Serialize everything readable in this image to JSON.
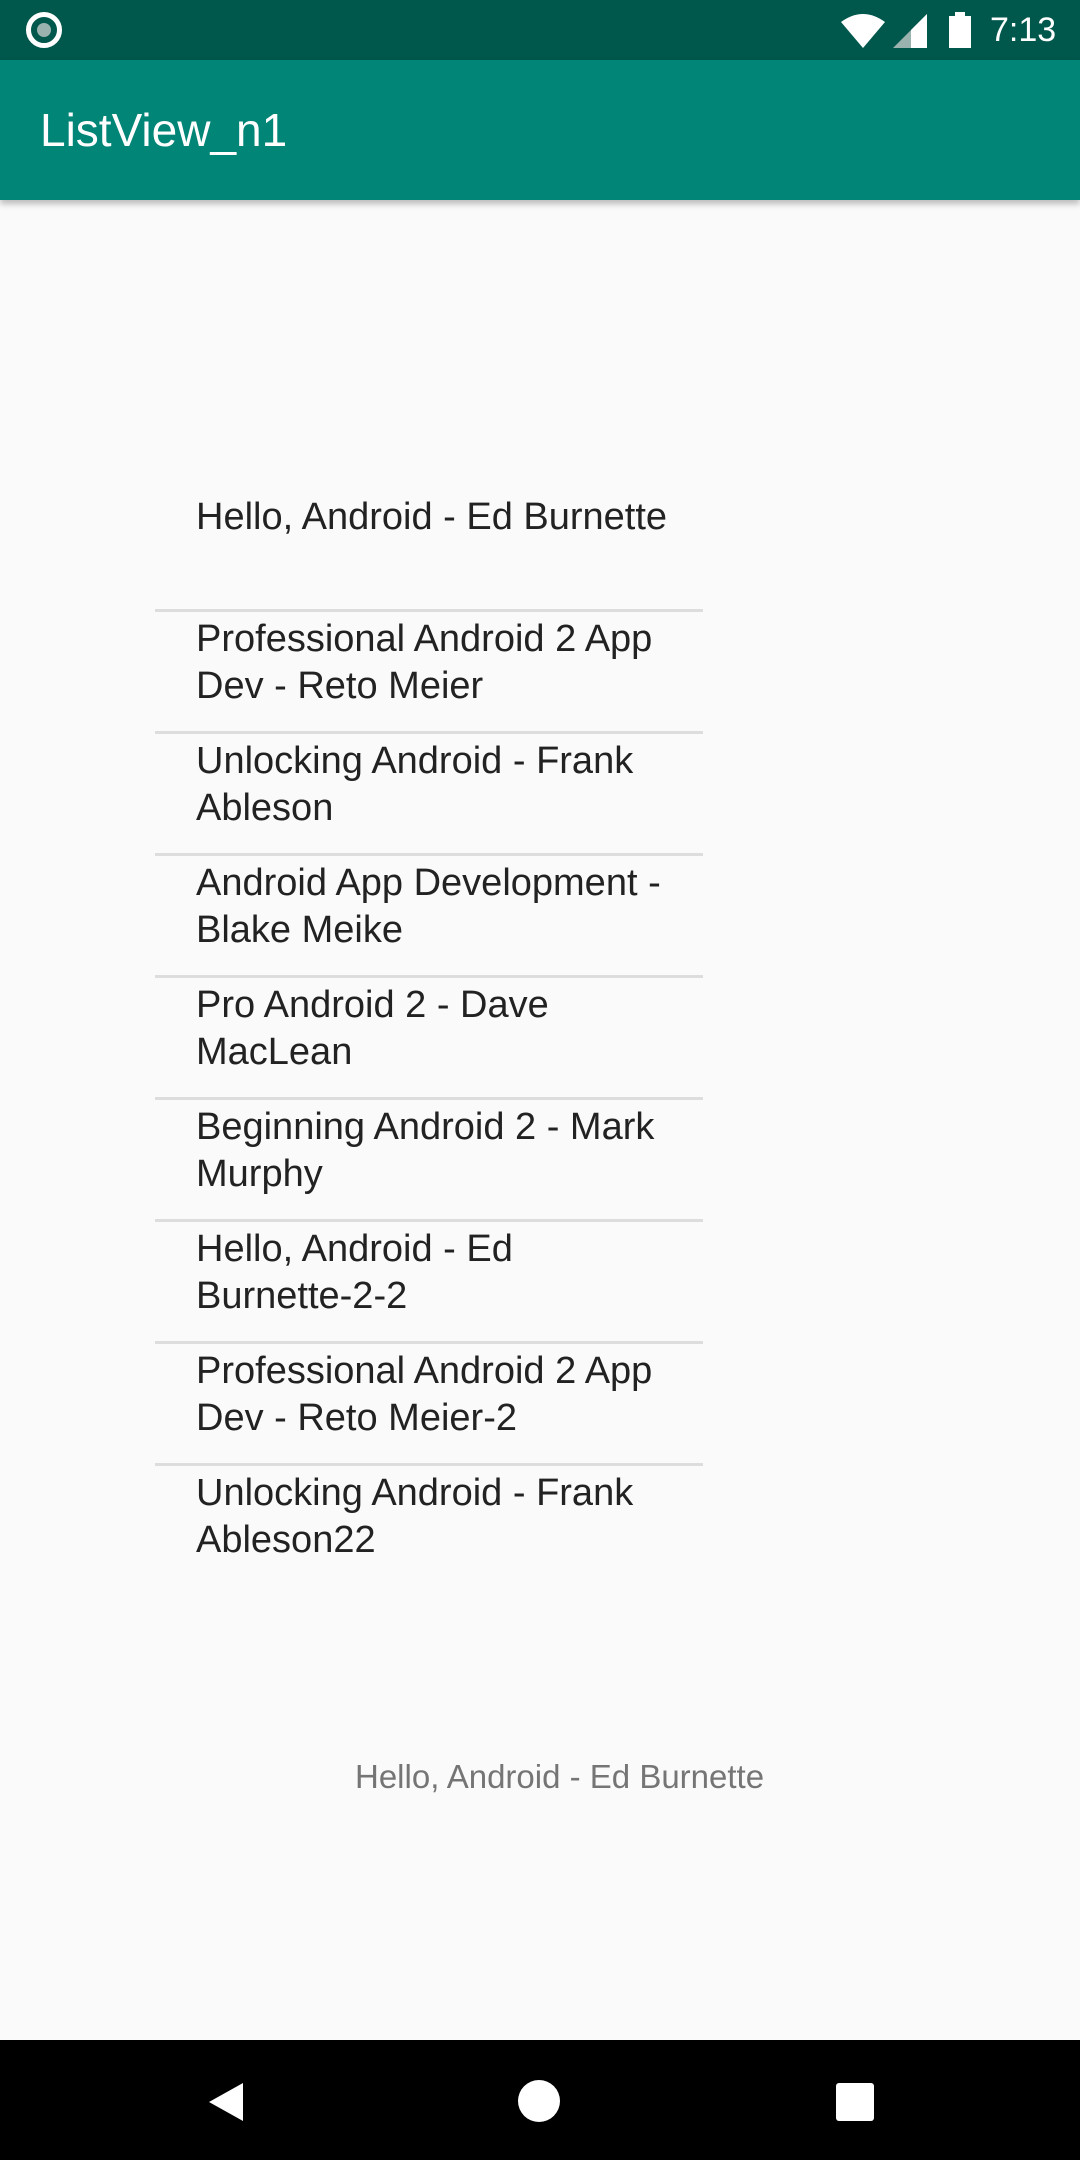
{
  "status_bar": {
    "time": "7:13",
    "icons": [
      "notification-dot-icon",
      "wifi-icon",
      "cell-signal-icon",
      "battery-icon"
    ]
  },
  "app_bar": {
    "title": "ListView_n1",
    "color": "#008577",
    "status_color": "#00574b"
  },
  "list": {
    "items": [
      {
        "label": "Hello, Android - Ed Burnette"
      },
      {
        "label": "Professional Android 2 App Dev - Reto Meier"
      },
      {
        "label": "Unlocking Android - Frank Ableson"
      },
      {
        "label": "Android App Development - Blake Meike"
      },
      {
        "label": "Pro Android 2 - Dave MacLean"
      },
      {
        "label": "Beginning Android 2 - Mark Murphy"
      },
      {
        "label": "Hello, Android - Ed Burnette-2-2"
      },
      {
        "label": "Professional Android 2 App Dev - Reto Meier-2"
      },
      {
        "label": "Unlocking Android - Frank Ableson22"
      }
    ]
  },
  "selection": {
    "text": "Hello, Android - Ed Burnette"
  },
  "nav_bar": {
    "icons": [
      "back-icon",
      "home-icon",
      "recents-icon"
    ]
  }
}
